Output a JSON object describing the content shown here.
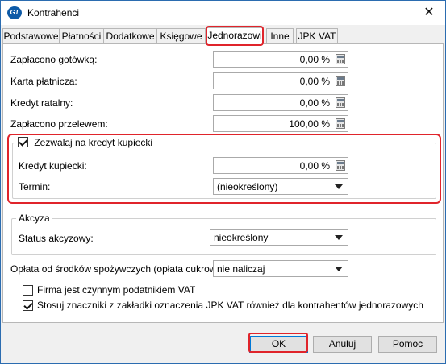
{
  "window": {
    "title": "Kontrahenci",
    "app_icon_text": "GT",
    "close_glyph": "✕"
  },
  "tabs": [
    {
      "label": "Podstawowe"
    },
    {
      "label": "Płatności"
    },
    {
      "label": "Dodatkowe"
    },
    {
      "label": "Księgowe"
    },
    {
      "label": "Jednorazowi",
      "active": true
    },
    {
      "label": "Inne"
    },
    {
      "label": "JPK VAT"
    }
  ],
  "payments": [
    {
      "label": "Zapłacono gotówką:",
      "value": "0,00 %"
    },
    {
      "label": "Karta płatnicza:",
      "value": "0,00 %"
    },
    {
      "label": "Kredyt ratalny:",
      "value": "0,00 %"
    },
    {
      "label": "Zapłacono przelewem:",
      "value": "100,00 %"
    }
  ],
  "merchant_credit": {
    "checkbox_label": "Zezwalaj na kredyt kupiecki",
    "checked": true,
    "credit_label": "Kredyt kupiecki:",
    "credit_value": "0,00 %",
    "term_label": "Termin:",
    "term_value": "(nieokreślony)"
  },
  "excise": {
    "group_title": "Akcyza",
    "status_label": "Status akcyzowy:",
    "status_value": "nieokreślony"
  },
  "sugar_fee": {
    "label": "Opłata od środków spożywczych (opłata cukrowa):",
    "value": "nie naliczaj"
  },
  "options": [
    {
      "label": "Firma jest czynnym podatnikiem VAT",
      "checked": false
    },
    {
      "label": "Stosuj znaczniki z zakładki oznaczenia JPK VAT również dla kontrahentów jednorazowych",
      "checked": true
    }
  ],
  "buttons": {
    "ok": "OK",
    "cancel": "Anuluj",
    "help": "Pomoc"
  },
  "colors": {
    "highlight": "#e0242b",
    "window_border": "#2b6cb0",
    "default_button_border": "#0078d7"
  }
}
